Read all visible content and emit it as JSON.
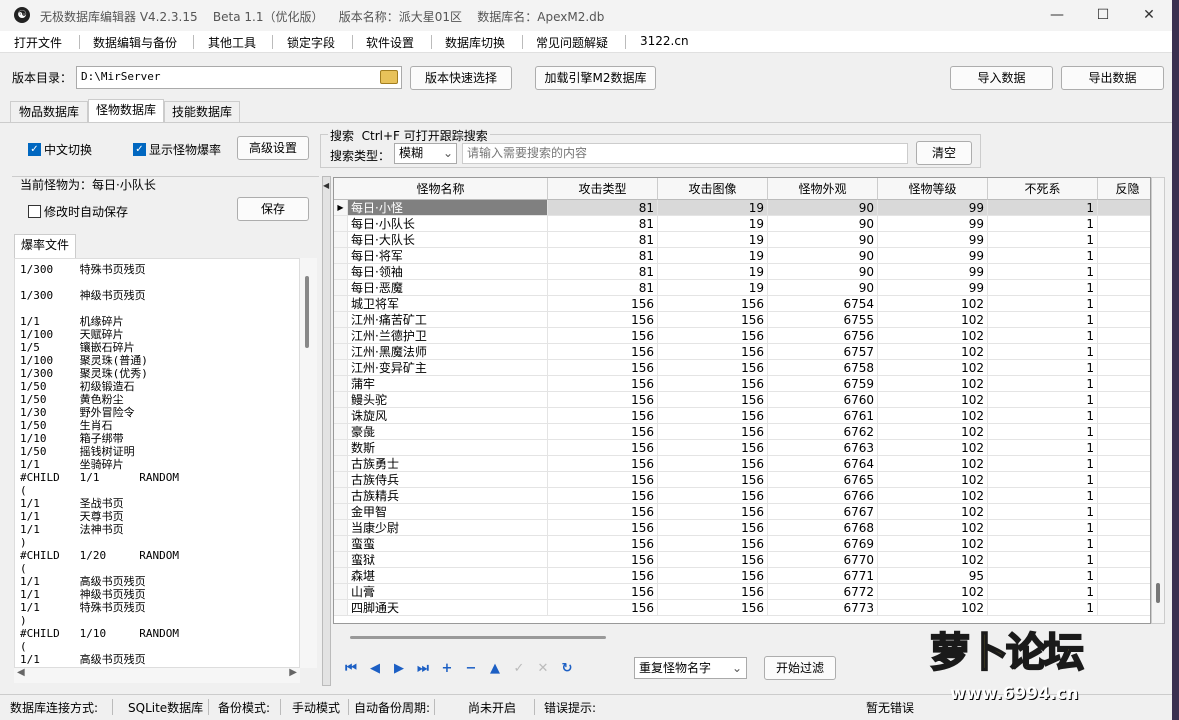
{
  "window": {
    "title": "无极数据库编辑器 V4.2.3.15    Beta 1.1（优化版）    版本名称：派大星01区    数据库名：ApexM2.db",
    "minimize": "—",
    "maximize": "☐",
    "close": "✕"
  },
  "menu": [
    "打开文件",
    "数据编辑与备份",
    "其他工具",
    "锁定字段",
    "软件设置",
    "数据库切换",
    "常见问题解疑",
    "3122.cn"
  ],
  "toolbar": {
    "dir_label": "版本目录：",
    "dir_value": "D:\\MirServer",
    "quick_select": "版本快速选择",
    "load_engine": "加载引擎M2数据库",
    "import": "导入数据",
    "export": "导出数据"
  },
  "tabs": [
    "物品数据库",
    "怪物数据库",
    "技能数据库"
  ],
  "options": {
    "chinese": "中文切换",
    "show_drop": "显示怪物爆率",
    "advanced": "高级设置"
  },
  "search": {
    "group_title": "搜索  Ctrl+F 可打开跟踪搜索",
    "type_label": "搜索类型：",
    "type_value": "模糊",
    "placeholder": "请输入需要搜索的内容",
    "clear": "清空"
  },
  "left": {
    "current_monster": "当前怪物为：每日·小队长",
    "autosave": "修改时自动保存",
    "save": "保存",
    "drop_tab": "爆率文件"
  },
  "drop_lines": [
    "1/300    特殊书页残页",
    "",
    "1/300    神级书页残页",
    "",
    "1/1      机缘碎片",
    "1/100    天赋碎片",
    "1/5      镶嵌石碎片",
    "1/100    聚灵珠(普通)",
    "1/300    聚灵珠(优秀)",
    "1/50     初级锻造石",
    "1/50     黄色粉尘",
    "1/30     野外冒险令",
    "1/50     生肖石",
    "1/10     箱子绑带",
    "1/50     摇钱树证明",
    "1/1      坐骑碎片",
    "#CHILD   1/1      RANDOM",
    "(",
    "1/1      圣战书页",
    "1/1      天尊书页",
    "1/1      法神书页",
    ")",
    "#CHILD   1/20     RANDOM",
    "(",
    "1/1      高级书页残页",
    "1/1      神级书页残页",
    "1/1      特殊书页残页",
    ")",
    "#CHILD   1/10     RANDOM",
    "(",
    "1/1      高级书页残页"
  ],
  "grid": {
    "columns": [
      "怪物名称",
      "攻击类型",
      "攻击图像",
      "怪物外观",
      "怪物等级",
      "不死系",
      "反隐"
    ],
    "rows": [
      [
        "每日·小怪",
        "81",
        "19",
        "90",
        "99",
        "1"
      ],
      [
        "每日·小队长",
        "81",
        "19",
        "90",
        "99",
        "1"
      ],
      [
        "每日·大队长",
        "81",
        "19",
        "90",
        "99",
        "1"
      ],
      [
        "每日·将军",
        "81",
        "19",
        "90",
        "99",
        "1"
      ],
      [
        "每日·领袖",
        "81",
        "19",
        "90",
        "99",
        "1"
      ],
      [
        "每日·恶魔",
        "81",
        "19",
        "90",
        "99",
        "1"
      ],
      [
        "城卫将军",
        "156",
        "156",
        "6754",
        "102",
        "1"
      ],
      [
        "江州·痛苦矿工",
        "156",
        "156",
        "6755",
        "102",
        "1"
      ],
      [
        "江州·兰德护卫",
        "156",
        "156",
        "6756",
        "102",
        "1"
      ],
      [
        "江州·黑魔法师",
        "156",
        "156",
        "6757",
        "102",
        "1"
      ],
      [
        "江州·变异矿主",
        "156",
        "156",
        "6758",
        "102",
        "1"
      ],
      [
        "蒲牢",
        "156",
        "156",
        "6759",
        "102",
        "1"
      ],
      [
        "鳗头驼",
        "156",
        "156",
        "6760",
        "102",
        "1"
      ],
      [
        "诛旋风",
        "156",
        "156",
        "6761",
        "102",
        "1"
      ],
      [
        "豪彘",
        "156",
        "156",
        "6762",
        "102",
        "1"
      ],
      [
        "数斯",
        "156",
        "156",
        "6763",
        "102",
        "1"
      ],
      [
        "古族勇士",
        "156",
        "156",
        "6764",
        "102",
        "1"
      ],
      [
        "古族侍兵",
        "156",
        "156",
        "6765",
        "102",
        "1"
      ],
      [
        "古族精兵",
        "156",
        "156",
        "6766",
        "102",
        "1"
      ],
      [
        "金甲智",
        "156",
        "156",
        "6767",
        "102",
        "1"
      ],
      [
        "当康少尉",
        "156",
        "156",
        "6768",
        "102",
        "1"
      ],
      [
        "蛮蛮",
        "156",
        "156",
        "6769",
        "102",
        "1"
      ],
      [
        "蛮狱",
        "156",
        "156",
        "6770",
        "102",
        "1"
      ],
      [
        "森堪",
        "156",
        "156",
        "6771",
        "95",
        "1"
      ],
      [
        "山膏",
        "156",
        "156",
        "6772",
        "102",
        "1"
      ],
      [
        "四脚通天",
        "156",
        "156",
        "6773",
        "102",
        "1"
      ]
    ]
  },
  "bottom": {
    "filter_select": "重复怪物名字",
    "filter_btn": "开始过滤"
  },
  "status": {
    "conn_label": "数据库连接方式:",
    "conn_value": "SQLite数据库",
    "backup_label": "备份模式:",
    "backup_value": "手动模式",
    "auto_label": "自动备份周期:",
    "auto_value": "尚未开启",
    "err_label": "错误提示:",
    "err_value": "暂无错误"
  },
  "watermark": {
    "logo": "萝卜论坛",
    "site": "www.6994.cn"
  }
}
